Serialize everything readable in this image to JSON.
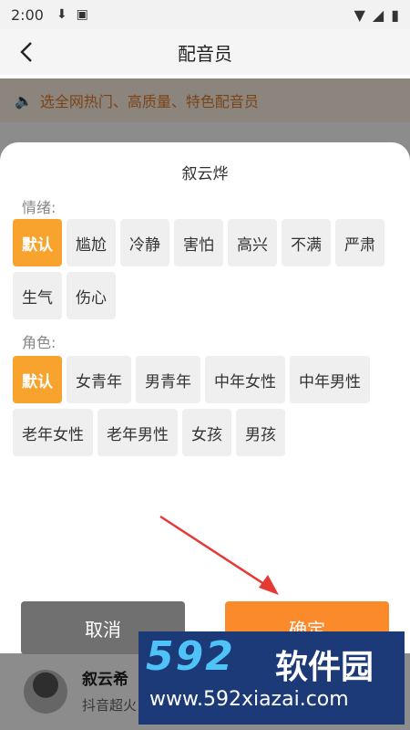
{
  "status_bar": {
    "time": "2:00"
  },
  "header": {
    "title": "配音员"
  },
  "notice": {
    "text": "选全网热门、高质量、特色配音员"
  },
  "background_item": {
    "name": "叙云希",
    "desc": "抖音超火"
  },
  "dialog": {
    "title": "叙云烨",
    "emotion_label": "情绪:",
    "emotions": [
      "默认",
      "尴尬",
      "冷静",
      "害怕",
      "高兴",
      "不满",
      "严肃",
      "生气",
      "伤心"
    ],
    "role_label": "角色:",
    "roles": [
      "默认",
      "女青年",
      "男青年",
      "中年女性",
      "中年男性",
      "老年女性",
      "老年男性",
      "女孩",
      "男孩"
    ],
    "cancel_label": "取消",
    "ok_label": "确定"
  },
  "watermark": {
    "brand": "592",
    "cn": "软件园",
    "url": "www.592xiazai.com"
  },
  "colors": {
    "accent": "#f7a32d",
    "confirm": "#fa8a2a",
    "cancel": "#707070",
    "notice_text": "#e47a2a"
  }
}
